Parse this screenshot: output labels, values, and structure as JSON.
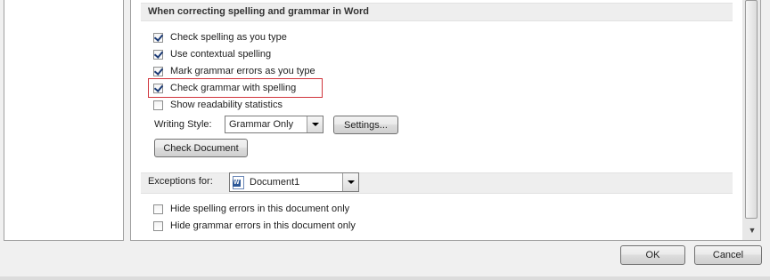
{
  "section_correcting": {
    "title": "When correcting spelling and grammar in Word",
    "options": [
      {
        "label": "Check spelling as you type",
        "checked": true
      },
      {
        "label": "Use contextual spelling",
        "checked": true
      },
      {
        "label": "Mark grammar errors as you type",
        "checked": true
      },
      {
        "label": "Check grammar with spelling",
        "checked": true
      },
      {
        "label": "Show readability statistics",
        "checked": false
      }
    ],
    "writing_style_label": "Writing Style:",
    "writing_style_value": "Grammar Only",
    "settings_button": "Settings...",
    "check_document_button": "Check Document"
  },
  "section_exceptions": {
    "label": "Exceptions for:",
    "document_value": "Document1",
    "options": [
      {
        "label": "Hide spelling errors in this document only",
        "checked": false
      },
      {
        "label": "Hide grammar errors in this document only",
        "checked": false
      }
    ]
  },
  "footer": {
    "ok_button": "OK",
    "cancel_button": "Cancel"
  },
  "icons": {
    "check_mark": "checkmark-icon",
    "dropdown": "chevron-down-icon",
    "document": "word-document-icon",
    "scroll_down": "scroll-down-arrow-icon"
  },
  "colors": {
    "highlight_border": "#d0343b",
    "check_color": "#1c3b76"
  }
}
